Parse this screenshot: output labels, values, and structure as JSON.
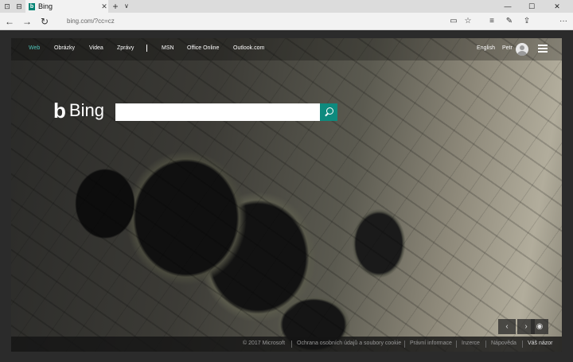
{
  "browser": {
    "tab_title": "Bing",
    "tab_favicon_letter": "b",
    "address_url": "bing.com/?cc=cz",
    "new_tab_symbol": "+",
    "tabs_chevron_symbol": "∨",
    "icons": {
      "set_aside": "⊡",
      "tab_preview": "⊟",
      "back": "←",
      "forward": "→",
      "refresh": "↻",
      "reading_view": "▭",
      "favorite": "☆",
      "hub": "≡",
      "note": "✎",
      "share": "⇪",
      "more": "···",
      "minimize": "—",
      "maximize": "☐",
      "close": "✕"
    }
  },
  "bing": {
    "logo_mark": "b",
    "logo_text": "Bing",
    "brand_color": "#0e8a7e",
    "active_nav_color": "#4fc3b8",
    "nav_left": [
      "Web",
      "Obrázky",
      "Videa",
      "Zprávy"
    ],
    "nav_right": [
      "MSN",
      "Office Online",
      "Outlook.com"
    ],
    "language": "English",
    "user_name": "Petr",
    "search_value": "",
    "image_prev": "‹",
    "image_next": "›",
    "image_camera": "◉",
    "footer": {
      "copyright": "© 2017 Microsoft",
      "links": [
        "Ochrana osobních údajů a soubory cookie",
        "Právní informace",
        "Inzerce",
        "Nápověda"
      ],
      "feedback": "Váš názor"
    }
  }
}
